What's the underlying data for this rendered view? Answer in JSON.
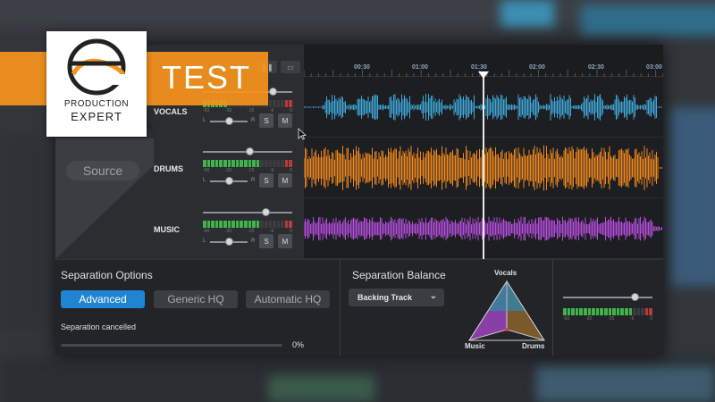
{
  "branding": {
    "badge_text": "TEST",
    "logo_line1": "PRODUCTION",
    "logo_line2": "EXPERT",
    "accent": "#f7941d"
  },
  "transport": {
    "pause_icon": "pause-icon",
    "loop_icon": "loop-icon"
  },
  "source_button": "Source",
  "timeline": {
    "ticks": [
      "00:30",
      "01:00",
      "01:30",
      "02:00",
      "02:30",
      "03:00"
    ]
  },
  "tracks": [
    {
      "name": "VOCALS",
      "color": "#3fa9dc",
      "solo": "S",
      "mute": "M",
      "volume": 0.78,
      "pan": 0.5
    },
    {
      "name": "DRUMS",
      "color": "#f2891e",
      "solo": "S",
      "mute": "M",
      "volume": 0.52,
      "pan": 0.5
    },
    {
      "name": "MUSIC",
      "color": "#b74ee0",
      "solo": "S",
      "mute": "M",
      "volume": 0.7,
      "pan": 0.5
    }
  ],
  "meter_scale": [
    "-60",
    "-30",
    "-15",
    "-6",
    "0"
  ],
  "pan_labels": {
    "left": "L",
    "right": "R"
  },
  "separation_options": {
    "title": "Separation Options",
    "modes": [
      "Advanced",
      "Generic HQ",
      "Automatic HQ"
    ],
    "active_mode": "Advanced",
    "status": "Separation cancelled",
    "progress_percent": "0%",
    "progress": 0
  },
  "separation_balance": {
    "title": "Separation Balance",
    "preset": "Backing Track",
    "corners": {
      "top": "Vocals",
      "left": "Music",
      "right": "Drums"
    },
    "colors": {
      "vocals": "#3a7f9a",
      "music": "#8a3fa8",
      "drums": "#7a5a2c"
    }
  },
  "output": {
    "volume": 0.8
  }
}
